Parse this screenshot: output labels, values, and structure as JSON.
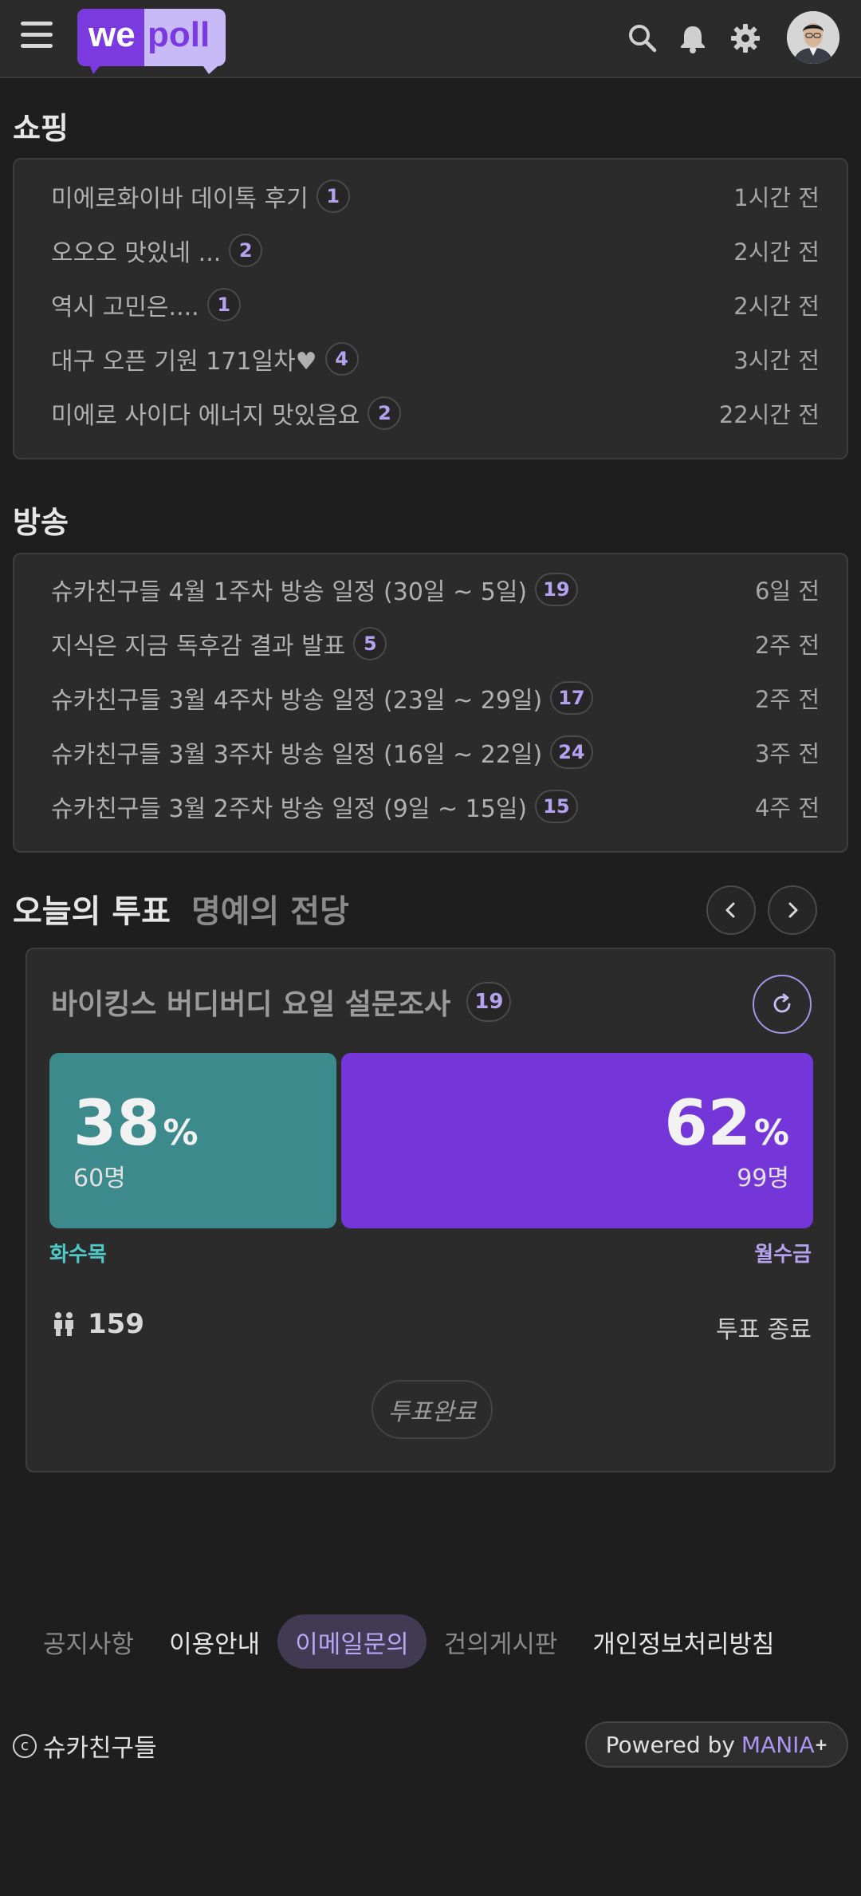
{
  "header": {
    "logo_text_a": "we",
    "logo_text_b": "poll",
    "icons": [
      "hamburger-menu-icon",
      "search-icon",
      "bell-icon",
      "gear-icon"
    ]
  },
  "shopping": {
    "title": "쇼핑",
    "items": [
      {
        "title": "미에로화이바 데이톡 후기",
        "count": "1",
        "time": "1시간 전"
      },
      {
        "title": "오오오 맛있네 ...",
        "count": "2",
        "time": "2시간 전"
      },
      {
        "title": "역시 고민은....",
        "count": "1",
        "time": "2시간 전"
      },
      {
        "title": "대구 오픈 기원 171일차♥",
        "count": "4",
        "time": "3시간 전"
      },
      {
        "title": "미에로 사이다 에너지 맛있음요",
        "count": "2",
        "time": "22시간 전"
      }
    ]
  },
  "broadcast": {
    "title": "방송",
    "items": [
      {
        "title": "슈카친구들 4월 1주차 방송 일정 (30일 ~ 5일)",
        "count": "19",
        "time": "6일 전"
      },
      {
        "title": "지식은 지금 독후감 결과 발표",
        "count": "5",
        "time": "2주 전"
      },
      {
        "title": "슈카친구들 3월 4주차 방송 일정 (23일 ~ 29일)",
        "count": "17",
        "time": "2주 전"
      },
      {
        "title": "슈카친구들 3월 3주차 방송 일정 (16일 ~ 22일)",
        "count": "24",
        "time": "3주 전"
      },
      {
        "title": "슈카친구들 3월 2주차 방송 일정 (9일 ~ 15일)",
        "count": "15",
        "time": "4주 전"
      }
    ]
  },
  "vote": {
    "tab_active": "오늘의 투표",
    "tab_inactive": "명예의 전당",
    "poll_title": "바이킹스 버디버디 요일 설문조사",
    "comment_count": "19",
    "option_a": {
      "percent": "38",
      "unit": "%",
      "count": "60명",
      "label": "화수목",
      "color": "#3c8a8c",
      "label_color": "#4fc9c7"
    },
    "option_b": {
      "percent": "62",
      "unit": "%",
      "count": "99명",
      "label": "월수금",
      "color": "#7436d9",
      "label_color": "#b3a2ee"
    },
    "total_voters": "159",
    "status": "투표 종료",
    "done_button": "투표완료"
  },
  "footer": {
    "links": [
      "공지사항",
      "이용안내",
      "이메일문의",
      "건의게시판",
      "개인정보처리방침"
    ],
    "copyright_symbol": "c",
    "copyright": "슈카친구들",
    "powered_prefix": "Powered by",
    "powered_brand": "MANIA",
    "powered_sup": "+"
  }
}
